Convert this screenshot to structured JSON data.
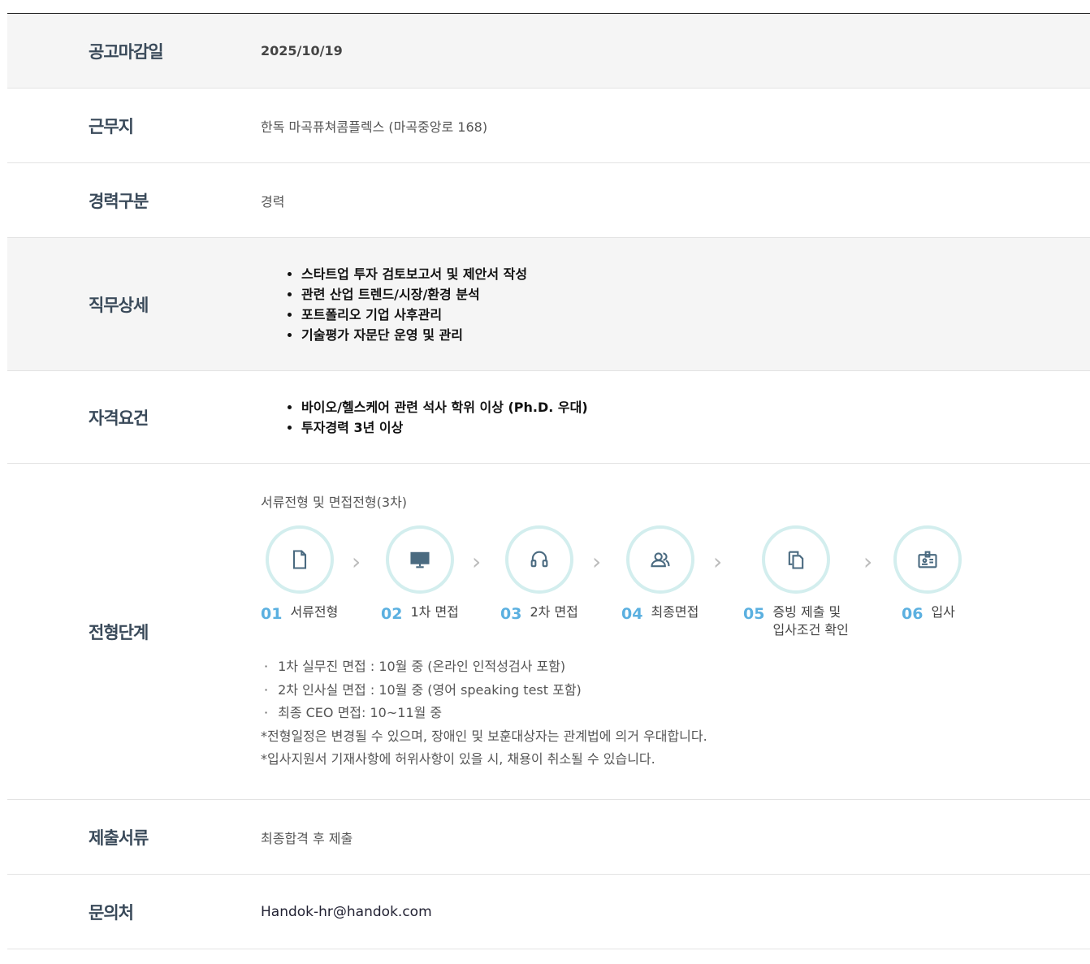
{
  "rows": {
    "deadline": {
      "label": "공고마감일",
      "value": "2025/10/19"
    },
    "location": {
      "label": "근무지",
      "value": "한독 마곡퓨쳐콤플렉스 (마곡중앙로 168)"
    },
    "career": {
      "label": "경력구분",
      "value": "경력"
    },
    "duty": {
      "label": "직무상세",
      "items": [
        "스타트업 투자 검토보고서 및 제안서 작성",
        "관련 산업 트렌드/시장/환경 분석",
        "포트폴리오 기업 사후관리",
        "기술평가 자문단 운영 및 관리"
      ]
    },
    "qualification": {
      "label": "자격요건",
      "items": [
        "바이오/헬스케어 관련 석사 학위 이상 (Ph.D. 우대)",
        "투자경력 3년 이상"
      ]
    },
    "process": {
      "label": "전형단계",
      "title": "서류전형 및 면접전형(3차)",
      "steps": [
        {
          "num": "01",
          "text": "서류전형",
          "icon": "document-icon"
        },
        {
          "num": "02",
          "text": "1차 면접",
          "icon": "monitor-icon"
        },
        {
          "num": "03",
          "text": "2차 면접",
          "icon": "headset-icon"
        },
        {
          "num": "04",
          "text": "최종면접",
          "icon": "people-icon"
        },
        {
          "num": "05",
          "text1": "증빙 제출 및",
          "text2": "입사조건 확인",
          "icon": "copy-document-icon"
        },
        {
          "num": "06",
          "text": "입사",
          "icon": "id-card-icon"
        }
      ],
      "notes": [
        "1차 실무진 면접 : 10월 중 (온라인 인적성검사 포함)",
        "2차 인사실 면접 : 10월 중 (영어 speaking test 포함)",
        "최종 CEO 면접: 10~11월 중"
      ],
      "remarks": [
        "*전형일정은 변경될 수 있으며, 장애인 및 보훈대상자는 관계법에 의거 우대합니다.",
        "*입사지원서 기재사항에 허위사항이 있을 시, 채용이 취소될 수 있습니다."
      ]
    },
    "documents": {
      "label": "제출서류",
      "value": "최종합격 후 제출"
    },
    "contact": {
      "label": "문의처",
      "value": "Handok-hr@handok.com"
    }
  },
  "colors": {
    "accent": "#5bb0e0",
    "circle_border": "#d3eeee",
    "icon": "#4a6a80"
  }
}
